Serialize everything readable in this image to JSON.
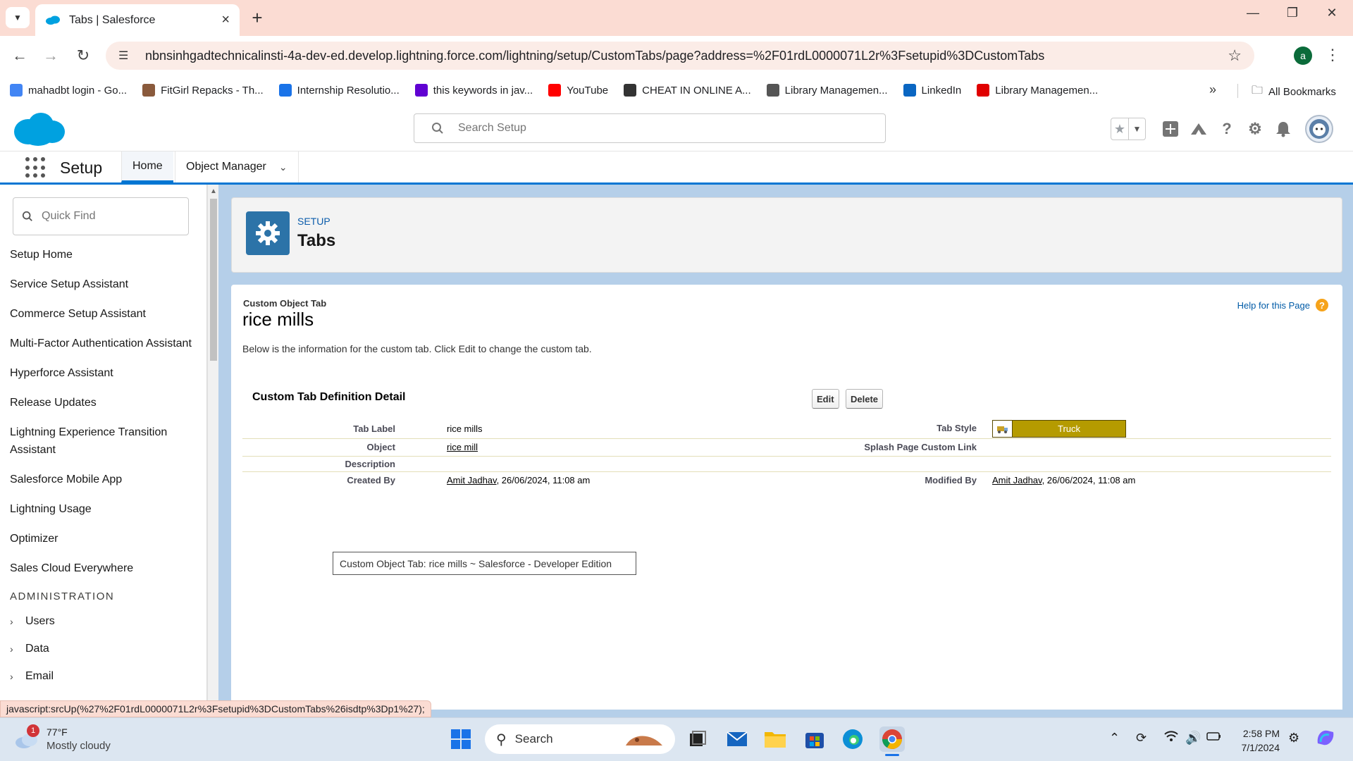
{
  "browser": {
    "tab_title": "Tabs | Salesforce",
    "url": "nbnsinhgadtechnicalinsti-4a-dev-ed.develop.lightning.force.com/lightning/setup/CustomTabs/page?address=%2F01rdL0000071L2r%3Fsetupid%3DCustomTabs",
    "profile_initial": "a",
    "new_tab": "+",
    "bookmarks": [
      {
        "label": "mahadbt login - Go...",
        "icon": "google-icon",
        "color": "#4285f4"
      },
      {
        "label": "FitGirl Repacks - Th...",
        "icon": "fitgirl-icon",
        "color": "#8a5a3c"
      },
      {
        "label": "Internship Resolutio...",
        "icon": "is-icon",
        "color": "#1a73e8"
      },
      {
        "label": "this keywords in jav...",
        "icon": "yahoo-icon",
        "color": "#6001d2"
      },
      {
        "label": "YouTube",
        "icon": "youtube-icon",
        "color": "#ff0000"
      },
      {
        "label": "CHEAT IN ONLINE A...",
        "icon": "github-icon",
        "color": "#333333"
      },
      {
        "label": "Library Managemen...",
        "icon": "link-icon",
        "color": "#555555"
      },
      {
        "label": "LinkedIn",
        "icon": "linkedin-icon",
        "color": "#0a66c2"
      },
      {
        "label": "Library Managemen...",
        "icon": "v-icon",
        "color": "#e00000"
      }
    ],
    "all_bookmarks": "All Bookmarks",
    "status_url": "javascript:srcUp(%27%2F01rdL0000071L2r%3Fsetupid%3DCustomTabs%26isdtp%3Dp1%27);"
  },
  "sf": {
    "search_placeholder": "Search Setup",
    "app_name": "Setup",
    "nav_tabs": [
      {
        "label": "Home",
        "active": true
      },
      {
        "label": "Object Manager",
        "active": false
      }
    ],
    "quick_find_placeholder": "Quick Find",
    "sidebar_items": [
      "Setup Home",
      "Service Setup Assistant",
      "Commerce Setup Assistant",
      "Multi-Factor Authentication Assistant",
      "Hyperforce Assistant",
      "Release Updates",
      "Lightning Experience Transition Assistant",
      "Salesforce Mobile App",
      "Lightning Usage",
      "Optimizer",
      "Sales Cloud Everywhere"
    ],
    "sidebar_section": "ADMINISTRATION",
    "sidebar_expandables": [
      "Users",
      "Data",
      "Email"
    ],
    "page_eyebrow": "SETUP",
    "page_title": "Tabs",
    "brand_color": "#0176d3"
  },
  "detail": {
    "type_label": "Custom Object Tab",
    "title": "rice mills",
    "help_link": "Help for this Page",
    "description": "Below is the information for the custom tab. Click Edit to change the custom tab.",
    "section_title": "Custom Tab Definition Detail",
    "edit_label": "Edit",
    "delete_label": "Delete",
    "fields": {
      "tab_label_lbl": "Tab Label",
      "tab_label_val": "rice mills",
      "tab_style_lbl": "Tab Style",
      "tab_style_val": "Truck",
      "object_lbl": "Object",
      "object_val": "rice mill",
      "splash_lbl": "Splash Page Custom Link",
      "description_lbl": "Description",
      "created_by_lbl": "Created By",
      "created_by_user": "Amit Jadhav",
      "created_by_date": ", 26/06/2024, 11:08 am",
      "modified_by_lbl": "Modified By",
      "modified_by_user": "Amit Jadhav",
      "modified_by_date": ", 26/06/2024, 11:08 am"
    },
    "tab_style_color": "#b59b00",
    "tooltip": "Custom Object Tab: rice mills ~ Salesforce - Developer Edition"
  },
  "taskbar": {
    "weather_temp": "77°F",
    "weather_cond": "Mostly cloudy",
    "weather_badge": "1",
    "search_label": "Search",
    "time": "2:58 PM",
    "date": "7/1/2024"
  }
}
